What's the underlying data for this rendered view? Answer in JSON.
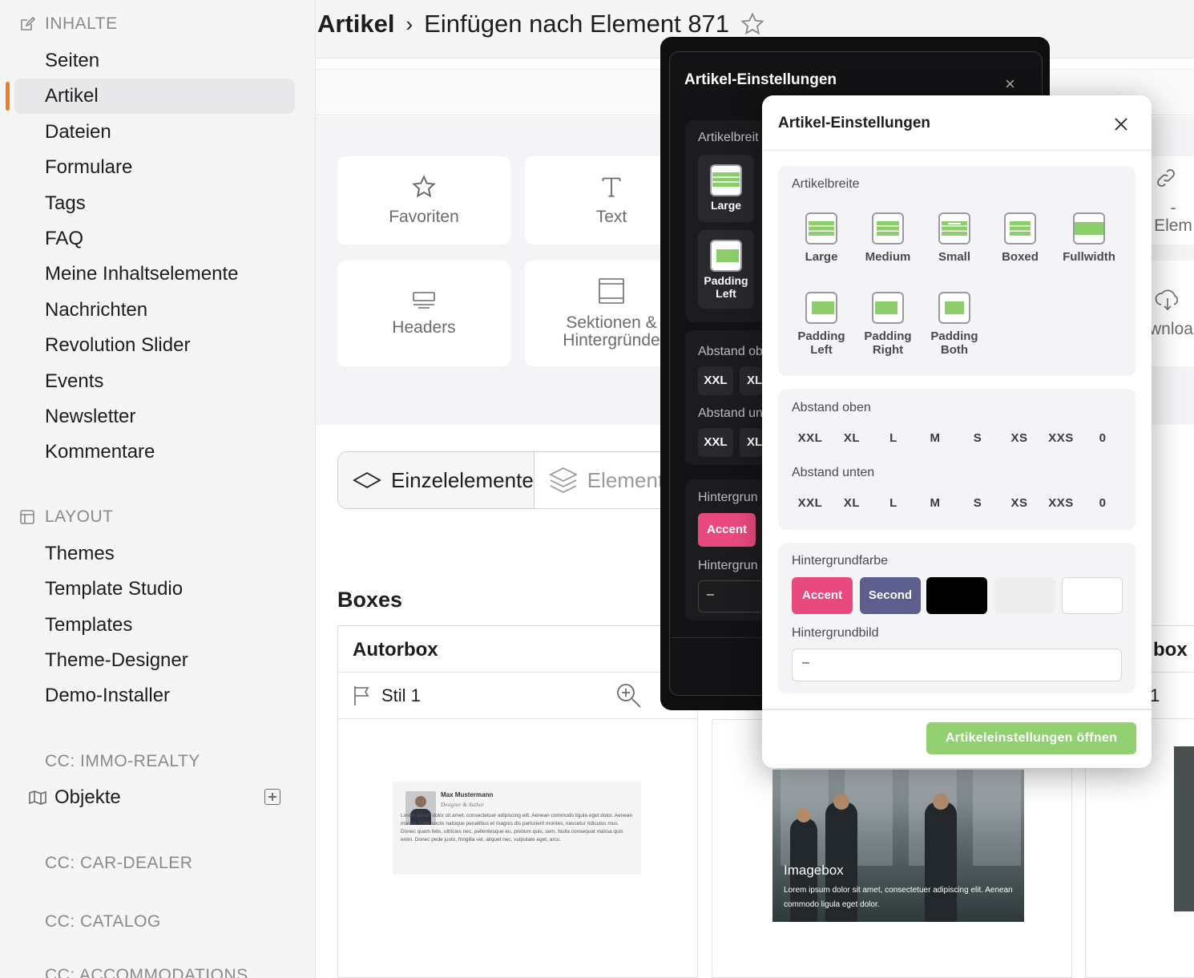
{
  "sidebar": {
    "section_inhalte": "INHALTE",
    "section_layout": "LAYOUT",
    "inhalte_items": [
      "Seiten",
      "Artikel",
      "Dateien",
      "Formulare",
      "Tags",
      "FAQ",
      "Meine Inhaltselemente",
      "Nachrichten",
      "Revolution Slider",
      "Events",
      "Newsletter",
      "Kommentare"
    ],
    "layout_items": [
      "Themes",
      "Template Studio",
      "Templates",
      "Theme-Designer",
      "Demo-Installer"
    ],
    "cc_immo": "CC: IMMO-REALTY",
    "objekte": "Objekte",
    "cc_car": "CC: CAR-DEALER",
    "cc_catalog": "CC: CATALOG",
    "cc_accommodations": "CC: ACCOMMODATIONS",
    "accent_color": "#f07c1e"
  },
  "header": {
    "title_main": "Artikel",
    "title_sep": "›",
    "title_sub": "Einfügen nach Element 871"
  },
  "palette": {
    "favoriten": "Favoriten",
    "text": "Text",
    "headers": "Headers",
    "sektionen_line1": "Sektionen &",
    "sektionen_line2": "Hintergründe",
    "right_elem": "-Elem",
    "right_download": "wnloa"
  },
  "tabs": {
    "einzelelemente": "Einzelelemente",
    "elemente": "Elemente"
  },
  "boxes": {
    "title": "Boxes",
    "autorbox": "Autorbox",
    "stil": "Stil 1",
    "right_box": "box",
    "right_stil": "1",
    "author_name": "Max Mustermann",
    "author_role": "Designer & Author",
    "author_text": "Lorem ipsum dolor sit amet, consectetuer adipiscing elit. Aenean commodo ligula eget dolor. Aenean massa. Cum sociis natoque penatibus et magnis dis parturient montes, nascetur ridiculus mus. Donec quam felis, ultricies nec, pellentesque eu, pretium quis, sem. Nulla consequat massa quis enim. Donec pede justo, fringilla vel, aliquet nec, vulputate eget, arcu.",
    "imagebox_title": "Imagebox",
    "imagebox_text": "Lorem ipsum dolor sit amet, consectetuer adipiscing elit. Aenean commodo ligula eget dolor."
  },
  "dark_dialog": {
    "title": "Artikel-Einstellungen",
    "close": "×",
    "artikelbreite": "Artikelbreit",
    "large": "Large",
    "padding_left_1": "Padding",
    "padding_left_2": "Left",
    "abstand_oben": "Abstand ob",
    "abstand_unten": "Abstand un",
    "xxl": "XXL",
    "xl": "XL",
    "hintergrund1": "Hintergrun",
    "accent": "Accent",
    "hintergrund2": "Hintergrun",
    "dash": "–"
  },
  "dialog": {
    "title": "Artikel-Einstellungen",
    "artikelbreite_label": "Artikelbreite",
    "width_options": [
      {
        "line1": "Large",
        "line2": ""
      },
      {
        "line1": "Medium",
        "line2": ""
      },
      {
        "line1": "Small",
        "line2": ""
      },
      {
        "line1": "Boxed",
        "line2": ""
      },
      {
        "line1": "Fullwidth",
        "line2": ""
      },
      {
        "line1": "Padding",
        "line2": "Left"
      },
      {
        "line1": "Padding",
        "line2": "Right"
      },
      {
        "line1": "Padding",
        "line2": "Both"
      }
    ],
    "abstand_oben_label": "Abstand oben",
    "abstand_unten_label": "Abstand unten",
    "spacing_options": [
      "XXL",
      "XL",
      "L",
      "M",
      "S",
      "XS",
      "XXS",
      "0"
    ],
    "hintergrundfarbe_label": "Hintergrundfarbe",
    "swatches": [
      {
        "label": "Accent",
        "color": "#e84a7f"
      },
      {
        "label": "Second",
        "color": "#5c5f8e"
      },
      {
        "label": "",
        "color": "#000000"
      },
      {
        "label": "",
        "color": "#ededee"
      },
      {
        "label": "",
        "color": "#ffffff"
      }
    ],
    "hintergrundbild_label": "Hintergrundbild",
    "hintergrundbild_value": "–",
    "open_button": "Artikeleinstellungen öffnen",
    "button_color": "#92d072"
  }
}
